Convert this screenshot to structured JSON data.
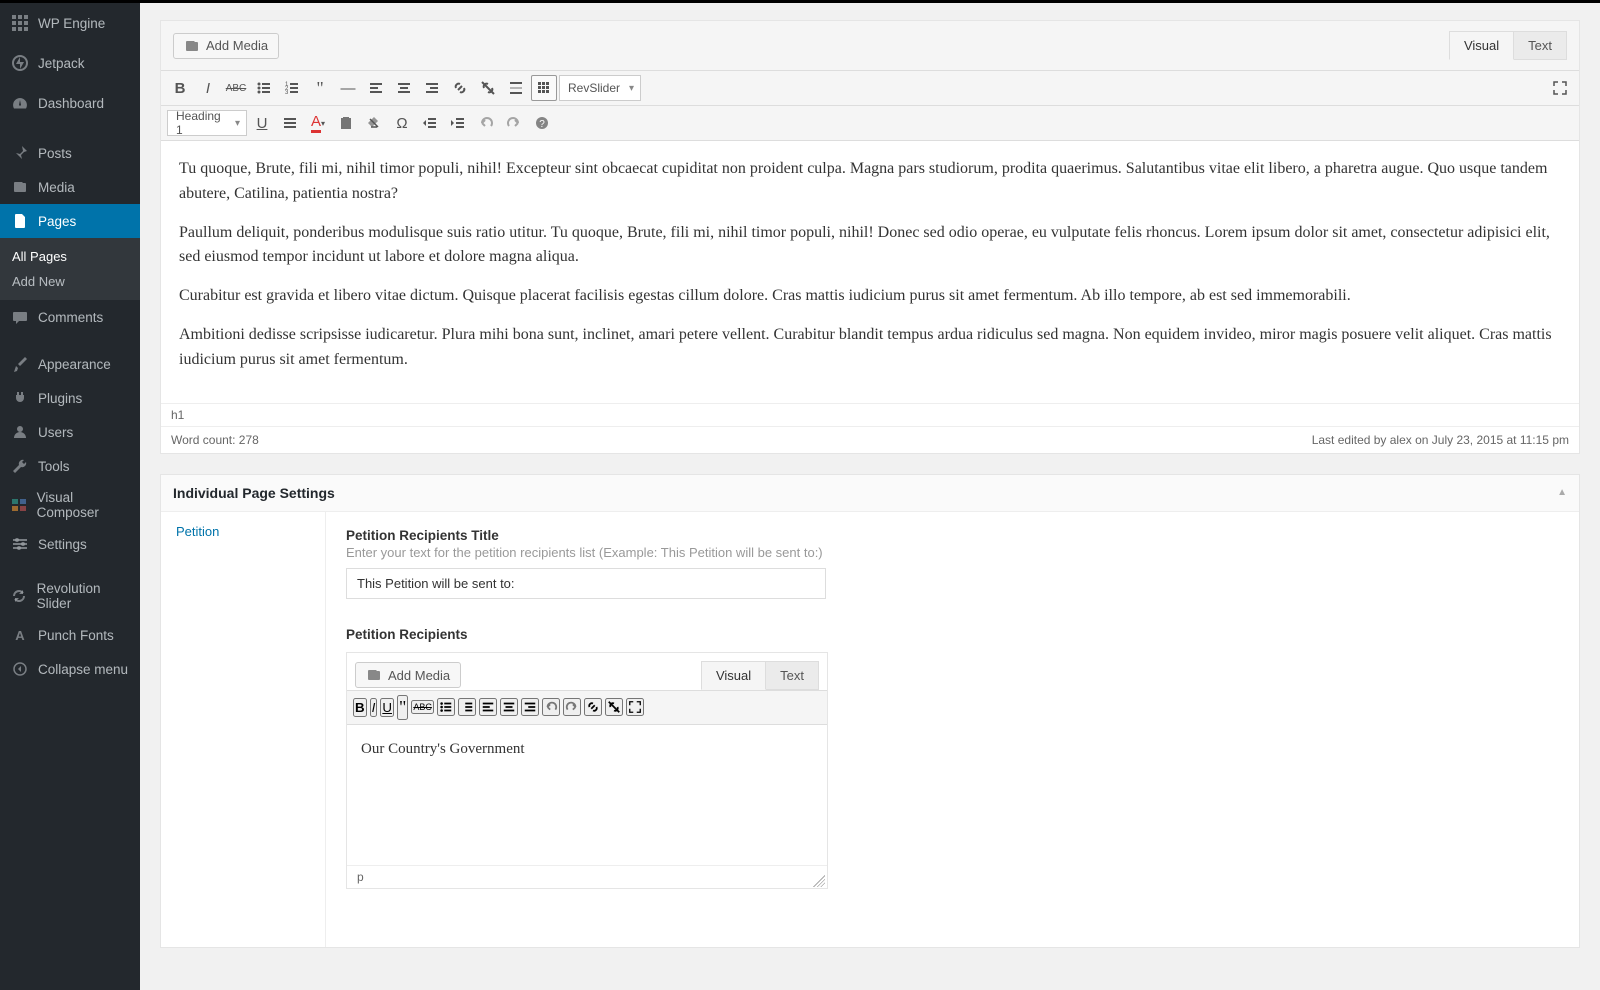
{
  "sidebar": {
    "items": [
      {
        "label": "WP Engine",
        "icon": "grid"
      },
      {
        "label": "Jetpack",
        "icon": "circle-slash"
      },
      {
        "label": "Dashboard",
        "icon": "gauge"
      },
      {
        "label": "Posts",
        "icon": "pin"
      },
      {
        "label": "Media",
        "icon": "media"
      },
      {
        "label": "Pages",
        "icon": "pages"
      },
      {
        "label": "Comments",
        "icon": "comment"
      },
      {
        "label": "Appearance",
        "icon": "brush"
      },
      {
        "label": "Plugins",
        "icon": "plug"
      },
      {
        "label": "Users",
        "icon": "user"
      },
      {
        "label": "Tools",
        "icon": "wrench"
      },
      {
        "label": "Visual Composer",
        "icon": "vc"
      },
      {
        "label": "Settings",
        "icon": "sliders"
      },
      {
        "label": "Revolution Slider",
        "icon": "refresh"
      },
      {
        "label": "Punch Fonts",
        "icon": "letter-a"
      },
      {
        "label": "Collapse menu",
        "icon": "collapse"
      }
    ],
    "submenu": {
      "all_pages": "All Pages",
      "add_new": "Add New"
    }
  },
  "editor": {
    "add_media": "Add Media",
    "tabs": {
      "visual": "Visual",
      "text": "Text"
    },
    "revslider": "RevSlider",
    "heading_dd": "Heading 1",
    "paragraphs": [
      "Tu quoque, Brute, fili mi, nihil timor populi, nihil! Excepteur sint obcaecat cupiditat non proident culpa. Magna pars studiorum, prodita quaerimus. Salutantibus vitae elit libero, a pharetra augue. Quo usque tandem abutere, Catilina, patientia nostra?",
      "Paullum deliquit, ponderibus modulisque suis ratio utitur. Tu quoque, Brute, fili mi, nihil timor populi, nihil! Donec sed odio operae, eu vulputate felis rhoncus. Lorem ipsum dolor sit amet, consectetur adipisici elit, sed eiusmod tempor incidunt ut labore et dolore magna aliqua.",
      "Curabitur est gravida et libero vitae dictum. Quisque placerat facilisis egestas cillum dolore. Cras mattis iudicium purus sit amet fermentum. Ab illo tempore, ab est sed immemorabili.",
      "Ambitioni dedisse scripsisse iudicaretur. Plura mihi bona sunt, inclinet, amari petere vellent. Curabitur blandit tempus ardua ridiculus sed magna. Non equidem invideo, miror magis posuere velit aliquet. Cras mattis iudicium purus sit amet fermentum."
    ],
    "path": "h1",
    "word_count": "Word count: 278",
    "last_edited": "Last edited by alex on July 23, 2015 at 11:15 pm"
  },
  "settings_box": {
    "title": "Individual Page Settings",
    "nav": {
      "petition": "Petition"
    },
    "recipients_title_label": "Petition Recipients Title",
    "recipients_title_desc": "Enter your text for the petition recipients list (Example: This Petition will be sent to:)",
    "recipients_title_value": "This Petition will be sent to:",
    "recipients_label": "Petition Recipients",
    "add_media": "Add Media",
    "tabs": {
      "visual": "Visual",
      "text": "Text"
    },
    "body": "Our Country's Government",
    "path": "p"
  },
  "toolbar_icons": {
    "row1": [
      "bold",
      "italic",
      "abc",
      "ul",
      "ol",
      "quote",
      "hr",
      "align-left",
      "align-center",
      "align-right",
      "link",
      "unlink",
      "insert",
      "more",
      "kitchen"
    ],
    "row2": [
      "underline",
      "align-justify",
      "textcolor",
      "paste",
      "clear",
      "omega",
      "outdent",
      "indent",
      "undo",
      "redo",
      "help"
    ],
    "mini": [
      "bold",
      "italic",
      "underline",
      "quote",
      "abc",
      "ul",
      "ol",
      "align-left",
      "align-center",
      "align-right",
      "undo",
      "redo",
      "link",
      "unlink",
      "fullscreen"
    ]
  }
}
